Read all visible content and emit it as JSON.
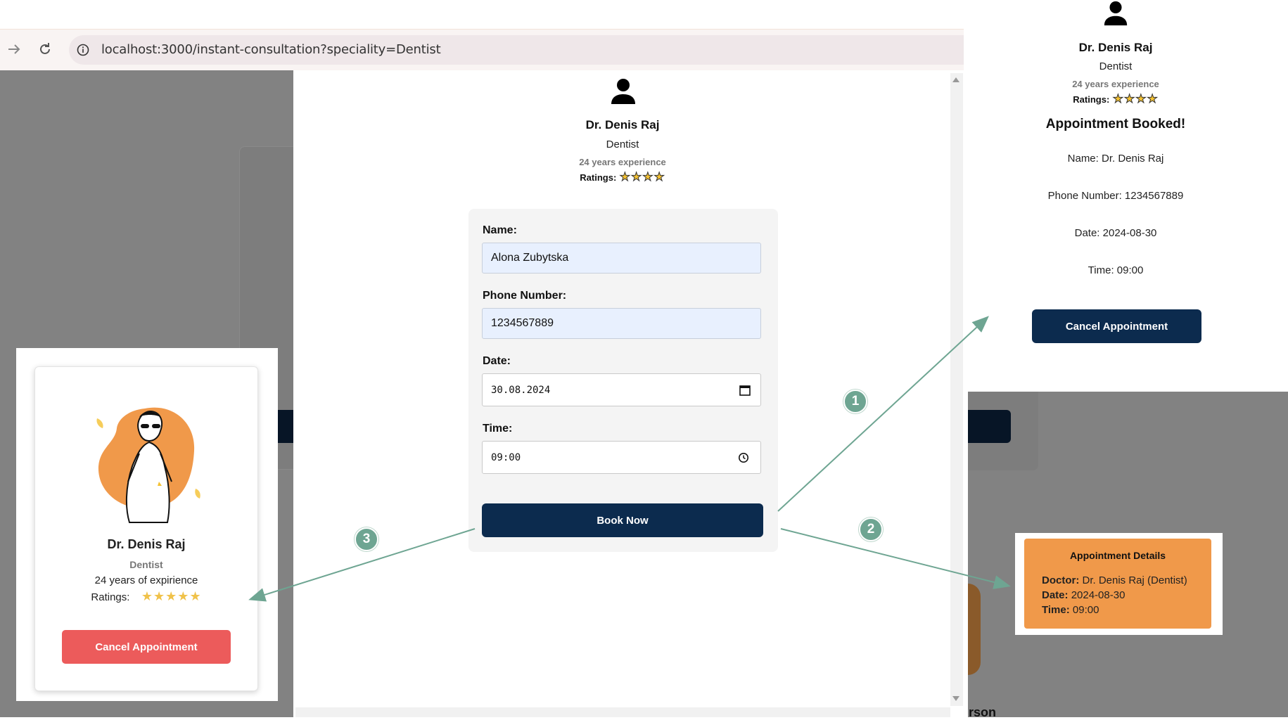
{
  "browser": {
    "url": "localhost:3000/instant-consultation?speciality=Dentist"
  },
  "doctor": {
    "name": "Dr. Denis Raj",
    "speciality": "Dentist",
    "experience": "24 years experience",
    "ratings_label": "Ratings:",
    "stars": "★★★★"
  },
  "form": {
    "name_label": "Name:",
    "name_value": "Alona Zubytska",
    "phone_label": "Phone Number:",
    "phone_value": "1234567889",
    "date_label": "Date:",
    "date_value": "30.08.2024",
    "time_label": "Time:",
    "time_value": "09:00",
    "submit_label": "Book Now"
  },
  "booked_panel": {
    "doctor_name": "Dr. Denis Raj",
    "speciality": "Dentist",
    "experience": "24 years experience",
    "ratings_label": "Ratings:",
    "stars": "★★★★",
    "heading": "Appointment Booked!",
    "name_line": "Name: Dr. Denis Raj",
    "phone_line": "Phone Number: 1234567889",
    "date_line": "Date: 2024-08-30",
    "time_line": "Time: 09:00",
    "cancel_label": "Cancel Appointment"
  },
  "left_card": {
    "doctor_name": "Dr. Denis Raj",
    "speciality": "Dentist",
    "experience": "24 years of expirience",
    "ratings_label": "Ratings:",
    "stars": "★★★★★",
    "cancel_label": "Cancel Appointment"
  },
  "details_popup": {
    "title": "Appointment Details",
    "doctor_key": "Doctor:",
    "doctor_value": "Dr. Denis Raj (Dentist)",
    "date_key": "Date:",
    "date_value": "2024-08-30",
    "time_key": "Time:",
    "time_value": "09:00"
  },
  "steps": [
    "1",
    "2",
    "3"
  ],
  "background_fragment": "rson",
  "colors": {
    "navy": "#0c2b4e",
    "orange": "#f0994a",
    "cancel_red": "#ec5b5b",
    "overlay_gray": "#828282",
    "arrow_green": "#6ea592"
  },
  "icons": [
    "back-arrow-icon",
    "reload-icon",
    "info-icon",
    "user-icon",
    "calendar-icon",
    "clock-icon",
    "star-icon"
  ]
}
